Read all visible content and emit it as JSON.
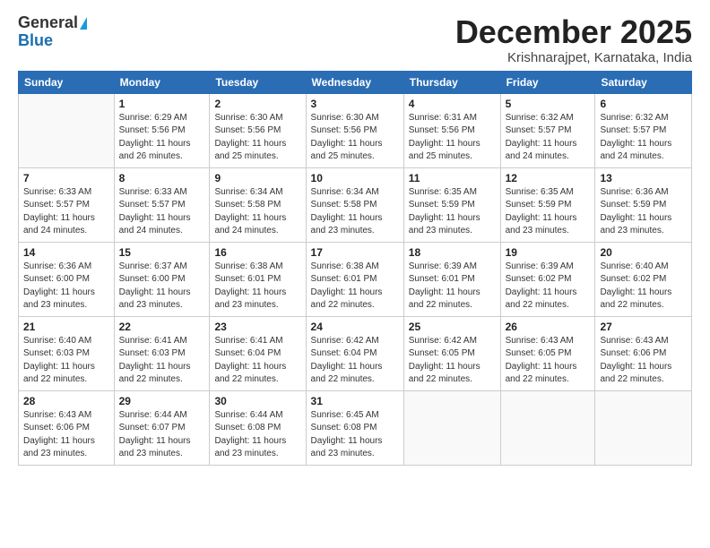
{
  "logo": {
    "general": "General",
    "blue": "Blue"
  },
  "title": "December 2025",
  "subtitle": "Krishnarajpet, Karnataka, India",
  "days_header": [
    "Sunday",
    "Monday",
    "Tuesday",
    "Wednesday",
    "Thursday",
    "Friday",
    "Saturday"
  ],
  "weeks": [
    [
      {
        "day": "",
        "info": ""
      },
      {
        "day": "1",
        "info": "Sunrise: 6:29 AM\nSunset: 5:56 PM\nDaylight: 11 hours\nand 26 minutes."
      },
      {
        "day": "2",
        "info": "Sunrise: 6:30 AM\nSunset: 5:56 PM\nDaylight: 11 hours\nand 25 minutes."
      },
      {
        "day": "3",
        "info": "Sunrise: 6:30 AM\nSunset: 5:56 PM\nDaylight: 11 hours\nand 25 minutes."
      },
      {
        "day": "4",
        "info": "Sunrise: 6:31 AM\nSunset: 5:56 PM\nDaylight: 11 hours\nand 25 minutes."
      },
      {
        "day": "5",
        "info": "Sunrise: 6:32 AM\nSunset: 5:57 PM\nDaylight: 11 hours\nand 24 minutes."
      },
      {
        "day": "6",
        "info": "Sunrise: 6:32 AM\nSunset: 5:57 PM\nDaylight: 11 hours\nand 24 minutes."
      }
    ],
    [
      {
        "day": "7",
        "info": "Sunrise: 6:33 AM\nSunset: 5:57 PM\nDaylight: 11 hours\nand 24 minutes."
      },
      {
        "day": "8",
        "info": "Sunrise: 6:33 AM\nSunset: 5:57 PM\nDaylight: 11 hours\nand 24 minutes."
      },
      {
        "day": "9",
        "info": "Sunrise: 6:34 AM\nSunset: 5:58 PM\nDaylight: 11 hours\nand 24 minutes."
      },
      {
        "day": "10",
        "info": "Sunrise: 6:34 AM\nSunset: 5:58 PM\nDaylight: 11 hours\nand 23 minutes."
      },
      {
        "day": "11",
        "info": "Sunrise: 6:35 AM\nSunset: 5:59 PM\nDaylight: 11 hours\nand 23 minutes."
      },
      {
        "day": "12",
        "info": "Sunrise: 6:35 AM\nSunset: 5:59 PM\nDaylight: 11 hours\nand 23 minutes."
      },
      {
        "day": "13",
        "info": "Sunrise: 6:36 AM\nSunset: 5:59 PM\nDaylight: 11 hours\nand 23 minutes."
      }
    ],
    [
      {
        "day": "14",
        "info": "Sunrise: 6:36 AM\nSunset: 6:00 PM\nDaylight: 11 hours\nand 23 minutes."
      },
      {
        "day": "15",
        "info": "Sunrise: 6:37 AM\nSunset: 6:00 PM\nDaylight: 11 hours\nand 23 minutes."
      },
      {
        "day": "16",
        "info": "Sunrise: 6:38 AM\nSunset: 6:01 PM\nDaylight: 11 hours\nand 23 minutes."
      },
      {
        "day": "17",
        "info": "Sunrise: 6:38 AM\nSunset: 6:01 PM\nDaylight: 11 hours\nand 22 minutes."
      },
      {
        "day": "18",
        "info": "Sunrise: 6:39 AM\nSunset: 6:01 PM\nDaylight: 11 hours\nand 22 minutes."
      },
      {
        "day": "19",
        "info": "Sunrise: 6:39 AM\nSunset: 6:02 PM\nDaylight: 11 hours\nand 22 minutes."
      },
      {
        "day": "20",
        "info": "Sunrise: 6:40 AM\nSunset: 6:02 PM\nDaylight: 11 hours\nand 22 minutes."
      }
    ],
    [
      {
        "day": "21",
        "info": "Sunrise: 6:40 AM\nSunset: 6:03 PM\nDaylight: 11 hours\nand 22 minutes."
      },
      {
        "day": "22",
        "info": "Sunrise: 6:41 AM\nSunset: 6:03 PM\nDaylight: 11 hours\nand 22 minutes."
      },
      {
        "day": "23",
        "info": "Sunrise: 6:41 AM\nSunset: 6:04 PM\nDaylight: 11 hours\nand 22 minutes."
      },
      {
        "day": "24",
        "info": "Sunrise: 6:42 AM\nSunset: 6:04 PM\nDaylight: 11 hours\nand 22 minutes."
      },
      {
        "day": "25",
        "info": "Sunrise: 6:42 AM\nSunset: 6:05 PM\nDaylight: 11 hours\nand 22 minutes."
      },
      {
        "day": "26",
        "info": "Sunrise: 6:43 AM\nSunset: 6:05 PM\nDaylight: 11 hours\nand 22 minutes."
      },
      {
        "day": "27",
        "info": "Sunrise: 6:43 AM\nSunset: 6:06 PM\nDaylight: 11 hours\nand 22 minutes."
      }
    ],
    [
      {
        "day": "28",
        "info": "Sunrise: 6:43 AM\nSunset: 6:06 PM\nDaylight: 11 hours\nand 23 minutes."
      },
      {
        "day": "29",
        "info": "Sunrise: 6:44 AM\nSunset: 6:07 PM\nDaylight: 11 hours\nand 23 minutes."
      },
      {
        "day": "30",
        "info": "Sunrise: 6:44 AM\nSunset: 6:08 PM\nDaylight: 11 hours\nand 23 minutes."
      },
      {
        "day": "31",
        "info": "Sunrise: 6:45 AM\nSunset: 6:08 PM\nDaylight: 11 hours\nand 23 minutes."
      },
      {
        "day": "",
        "info": ""
      },
      {
        "day": "",
        "info": ""
      },
      {
        "day": "",
        "info": ""
      }
    ]
  ]
}
